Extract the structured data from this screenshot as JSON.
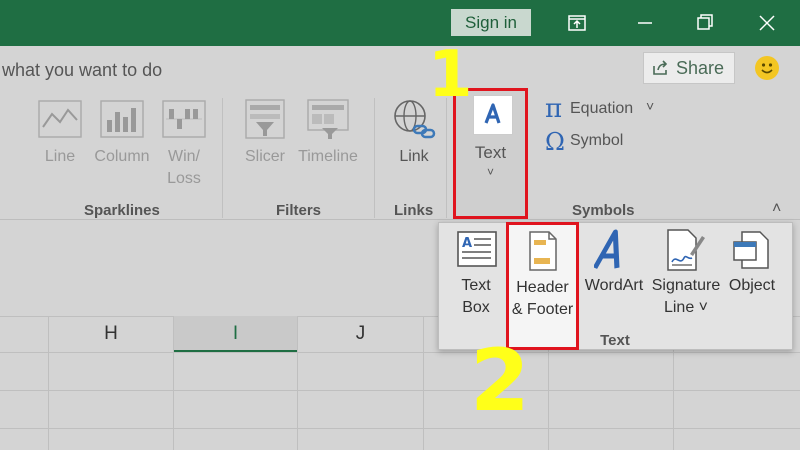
{
  "titlebar": {
    "sign_in_label": "Sign in"
  },
  "tellme": {
    "text": "what you want to do"
  },
  "share": {
    "label": "Share"
  },
  "ribbon": {
    "sparklines": {
      "label": "Sparklines",
      "buttons": [
        {
          "label": "Line"
        },
        {
          "label": "Column"
        },
        {
          "label": "Win/\nLoss"
        }
      ]
    },
    "filters": {
      "label": "Filters",
      "buttons": [
        {
          "label": "Slicer"
        },
        {
          "label": "Timeline"
        }
      ]
    },
    "links": {
      "label": "Links",
      "buttons": [
        {
          "label": "Link"
        }
      ]
    },
    "text_button": {
      "label": "Text",
      "chevron": "˅"
    },
    "symbols": {
      "label": "Symbols",
      "equation": "Equation",
      "symbol": "Symbol"
    }
  },
  "text_panel": {
    "label": "Text",
    "items": [
      {
        "label": "Text\nBox"
      },
      {
        "label": "Header\n& Footer"
      },
      {
        "label": "WordArt"
      },
      {
        "label": "Signature\nLine ˅"
      },
      {
        "label": "Object"
      }
    ]
  },
  "sheet": {
    "columns": [
      "H",
      "I",
      "J"
    ]
  },
  "annotations": {
    "step1": "1",
    "step2": "2"
  },
  "colors": {
    "titlebar": "#1f6e43",
    "highlight": "#e0141e",
    "annotation": "#ffff19"
  }
}
